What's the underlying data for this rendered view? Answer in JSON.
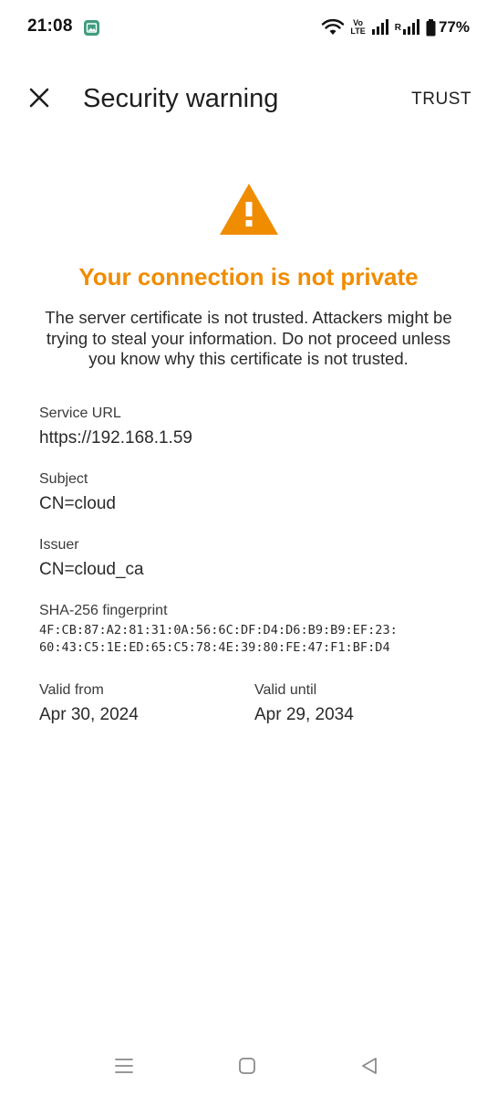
{
  "status_bar": {
    "time": "21:08",
    "network_label": "Vo\nLTE",
    "roaming_label": "R",
    "battery_percent": "77%",
    "icons": [
      "gallery-icon",
      "wifi-icon",
      "volte-icon",
      "signal-icon",
      "signal-icon",
      "battery-icon"
    ]
  },
  "app_bar": {
    "title": "Security warning",
    "trust_label": "TRUST",
    "close_icon": "close-icon"
  },
  "warning": {
    "icon": "warning-triangle-icon",
    "icon_color": "#F08C00",
    "title": "Your connection is not private",
    "title_color": "#F08C00",
    "body": "The server certificate is not trusted. Attackers might be trying to steal your information. Do not proceed unless you know why this certificate is not trusted."
  },
  "details": {
    "service_url": {
      "label": "Service URL",
      "value": "https://192.168.1.59"
    },
    "subject": {
      "label": "Subject",
      "value": "CN=cloud"
    },
    "issuer": {
      "label": "Issuer",
      "value": "CN=cloud_ca"
    },
    "fingerprint": {
      "label": "SHA-256 fingerprint",
      "line1": "4F:CB:87:A2:81:31:0A:56:6C:DF:D4:D6:B9:B9:EF:23:",
      "line2": "60:43:C5:1E:ED:65:C5:78:4E:39:80:FE:47:F1:BF:D4"
    },
    "valid_from": {
      "label": "Valid from",
      "value": "Apr 30, 2024"
    },
    "valid_until": {
      "label": "Valid until",
      "value": "Apr 29, 2034"
    }
  },
  "nav_bar": {
    "icons": [
      "menu-icon",
      "home-icon",
      "back-icon"
    ]
  }
}
